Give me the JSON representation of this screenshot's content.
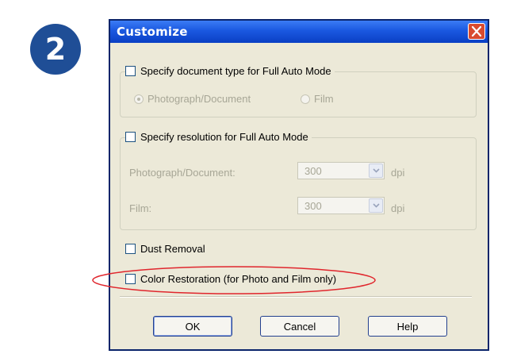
{
  "step_number": "2",
  "dialog": {
    "title": "Customize",
    "doc_type_group": {
      "checkbox_label": "Specify document type for Full Auto Mode",
      "radio_photo": "Photograph/Document",
      "radio_film": "Film"
    },
    "resolution_group": {
      "checkbox_label": "Specify resolution for Full Auto Mode",
      "photo_label": "Photograph/Document:",
      "photo_value": "300",
      "photo_unit": "dpi",
      "film_label": "Film:",
      "film_value": "300",
      "film_unit": "dpi"
    },
    "dust_removal_label": "Dust Removal",
    "color_restoration_label": "Color Restoration (for Photo and Film only)",
    "buttons": {
      "ok": "OK",
      "cancel": "Cancel",
      "help": "Help"
    }
  },
  "icons": {
    "close": "close-icon",
    "dropdown": "chevron-down-icon"
  },
  "colors": {
    "titlebar": "#1a58e0",
    "step_badge": "#1f4e96",
    "highlight_ellipse": "#e0262d",
    "close_button": "#d94b2f"
  }
}
